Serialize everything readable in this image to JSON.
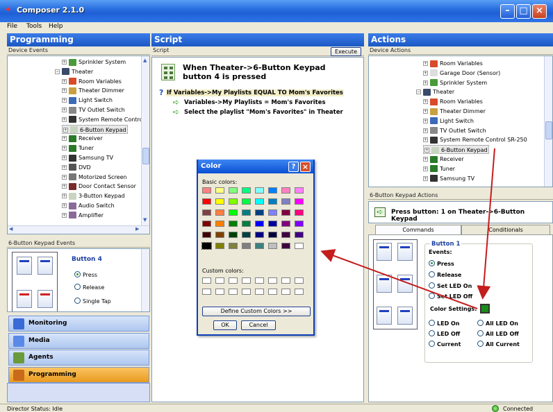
{
  "window": {
    "title": "Composer 2.1.0"
  },
  "menu": [
    "File",
    "Tools",
    "Help"
  ],
  "programming": {
    "title": "Programming",
    "device_events_label": "Device Events",
    "tree": [
      {
        "label": "Sprinkler System",
        "icon": "sprinkler-icon",
        "indent": 2
      },
      {
        "label": "Theater",
        "icon": "room-icon",
        "indent": 1
      },
      {
        "label": "Room Variables",
        "icon": "variables-icon",
        "indent": 2
      },
      {
        "label": "Theater Dimmer",
        "icon": "dimmer-icon",
        "indent": 2
      },
      {
        "label": "Light Switch",
        "icon": "switch-icon",
        "indent": 2
      },
      {
        "label": "TV Outlet Switch",
        "icon": "outlet-icon",
        "indent": 2
      },
      {
        "label": "System Remote Contro",
        "icon": "remote-icon",
        "indent": 2
      },
      {
        "label": "6-Button Keypad",
        "icon": "keypad-icon",
        "indent": 2,
        "selected": true
      },
      {
        "label": "Receiver",
        "icon": "receiver-icon",
        "indent": 2
      },
      {
        "label": "Tuner",
        "icon": "tuner-icon",
        "indent": 2
      },
      {
        "label": "Samsung TV",
        "icon": "tv-icon",
        "indent": 2
      },
      {
        "label": "DVD",
        "icon": "dvd-icon",
        "indent": 2
      },
      {
        "label": "Motorized Screen",
        "icon": "screen-icon",
        "indent": 2
      },
      {
        "label": "Door Contact Sensor",
        "icon": "door-icon",
        "indent": 2
      },
      {
        "label": "3-Button Keypad",
        "icon": "keypad-icon",
        "indent": 2
      },
      {
        "label": "Audio Switch",
        "icon": "audio-switch-icon",
        "indent": 2
      },
      {
        "label": "Amplifier",
        "icon": "amplifier-icon",
        "indent": 2
      }
    ],
    "keypad_events_label": "6-Button Keypad Events",
    "button_name": "Button 4",
    "events": [
      "Press",
      "Release",
      "Single Tap"
    ],
    "selected_event": "Press",
    "nav": [
      {
        "label": "Monitoring",
        "icon": "monitoring-icon"
      },
      {
        "label": "Media",
        "icon": "media-icon"
      },
      {
        "label": "Agents",
        "icon": "agents-icon"
      },
      {
        "label": "Programming",
        "icon": "programming-icon",
        "active": true
      }
    ]
  },
  "script": {
    "title": "Script",
    "sub_label": "Script",
    "execute_label": "Execute",
    "when_text": "When Theater->6-Button Keypad button 4 is pressed",
    "if_text": "If Variables->My Playlists EQUAL TO Mom's Favorites",
    "actions": [
      "Variables->My Playlists = Mom's Favorites",
      "Select the playlist \"Mom's Favorites\" in Theater"
    ]
  },
  "actions": {
    "title": "Actions",
    "device_actions_label": "Device Actions",
    "tree": [
      {
        "label": "Room Variables",
        "icon": "variables-icon",
        "indent": 3
      },
      {
        "label": "Garage Door (Sensor)",
        "icon": "garage-icon",
        "indent": 3
      },
      {
        "label": "Sprinkler System",
        "icon": "sprinkler-icon",
        "indent": 3
      },
      {
        "label": "Theater",
        "icon": "room-icon",
        "indent": 2
      },
      {
        "label": "Room Variables",
        "icon": "variables-icon",
        "indent": 3
      },
      {
        "label": "Theater Dimmer",
        "icon": "dimmer-icon",
        "indent": 3
      },
      {
        "label": "Light Switch",
        "icon": "switch-icon",
        "indent": 3
      },
      {
        "label": "TV Outlet Switch",
        "icon": "outlet-icon",
        "indent": 3
      },
      {
        "label": "System Remote Control SR-250",
        "icon": "remote-icon",
        "indent": 3
      },
      {
        "label": "6-Button Keypad",
        "icon": "keypad-icon",
        "indent": 3,
        "selected": true
      },
      {
        "label": "Receiver",
        "icon": "receiver-icon",
        "indent": 3
      },
      {
        "label": "Tuner",
        "icon": "tuner-icon",
        "indent": 3
      },
      {
        "label": "Samsung TV",
        "icon": "tv-icon",
        "indent": 3
      }
    ],
    "keypad_actions_label": "6-Button Keypad Actions",
    "press_text": "Press button: 1 on Theater->6-Button Keypad",
    "tabs": [
      "Commands",
      "Conditionals"
    ],
    "button_name": "Button 1",
    "events_label": "Events:",
    "events": [
      "Press",
      "Release",
      "Set LED On",
      "Set LED Off"
    ],
    "selected_event": "Press",
    "color_settings_label": "Color Settings:",
    "led_color": "#1a8c1a",
    "led_options_left": [
      "LED On",
      "LED Off",
      "Current"
    ],
    "led_options_right": [
      "All LED On",
      "All LED Off",
      "All Current"
    ]
  },
  "color_dialog": {
    "title": "Color",
    "basic_label": "Basic colors:",
    "basic_colors": [
      "#ff8080",
      "#ffff80",
      "#80ff80",
      "#00ff80",
      "#80ffff",
      "#0080ff",
      "#ff80c0",
      "#ff80ff",
      "#ff0000",
      "#ffff00",
      "#80ff00",
      "#00ff40",
      "#00ffff",
      "#0080c0",
      "#8080c0",
      "#ff00ff",
      "#804040",
      "#ff8040",
      "#00ff00",
      "#008080",
      "#004080",
      "#8080ff",
      "#800040",
      "#ff0080",
      "#800000",
      "#ff8000",
      "#008000",
      "#008040",
      "#0000ff",
      "#0000a0",
      "#800080",
      "#8000ff",
      "#400000",
      "#804000",
      "#004000",
      "#004040",
      "#000080",
      "#000040",
      "#400040",
      "#400080",
      "#000000",
      "#808000",
      "#808040",
      "#808080",
      "#408080",
      "#c0c0c0",
      "#400040",
      "#ffffff"
    ],
    "custom_label": "Custom colors:",
    "define_label": "Define Custom Colors >>",
    "ok_label": "OK",
    "cancel_label": "Cancel"
  },
  "status": {
    "left": "Director Status: Idle",
    "right": "Connected"
  }
}
